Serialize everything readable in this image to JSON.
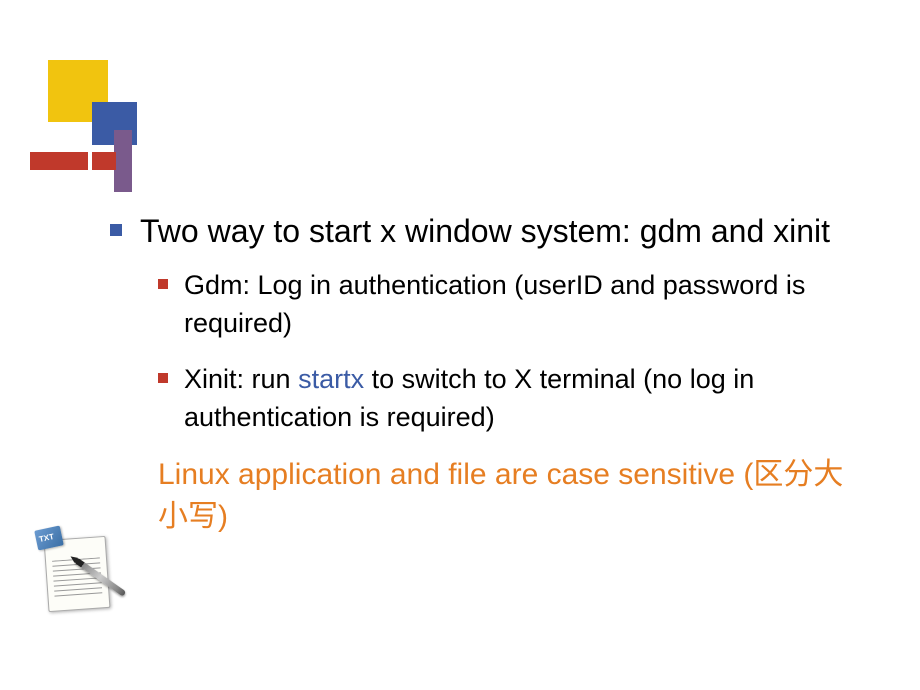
{
  "slide": {
    "bullet1": "Two way to start x window system: gdm and xinit",
    "sub1": "Gdm: Log in authentication (userID and password is required)",
    "sub2_pre": "Xinit: run ",
    "sub2_highlight": "startx",
    "sub2_post": " to switch to X terminal (no log in authentication is required)",
    "note": "Linux application and file are case sensitive (区分大小写)",
    "icon_tab": "TXT"
  }
}
